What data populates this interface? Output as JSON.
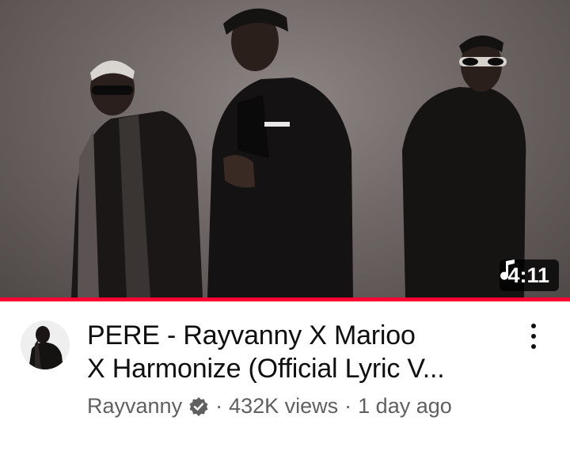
{
  "video": {
    "title_line1": "PERE - Rayvanny X Marioo",
    "title_line2": "X Harmonize (Official Lyric V...",
    "duration": "4:11",
    "progress": 1.0,
    "channel": "Rayvanny",
    "views": "432K views",
    "age": "1 day ago",
    "separator": "·"
  },
  "icons": {
    "duration": "music-note-icon",
    "verified": "verified-icon",
    "menu": "more-vert-icon"
  },
  "colors": {
    "progress": "#ff0033",
    "title": "#0f0f0f",
    "meta": "#606060"
  }
}
